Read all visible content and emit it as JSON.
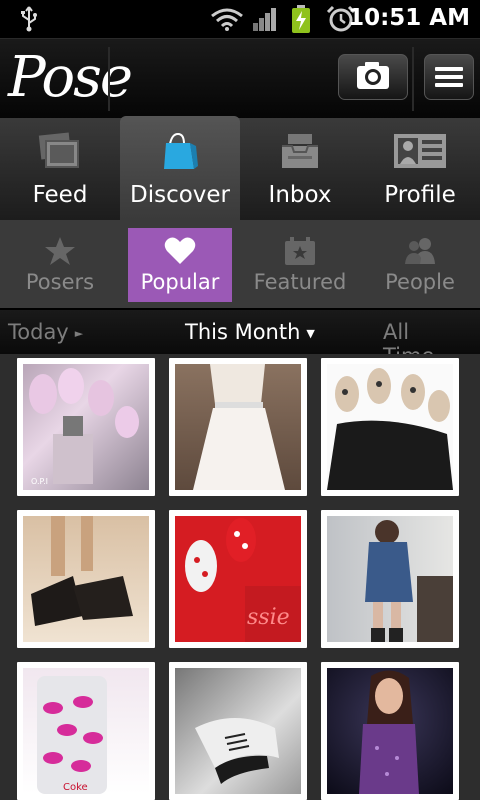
{
  "status_bar": {
    "time": "10:51 AM",
    "icons": [
      "usb-icon",
      "wifi-icon",
      "signal-icon",
      "battery-charging-icon",
      "alarm-icon"
    ]
  },
  "header": {
    "logo": "Pose",
    "camera_icon": "camera-icon",
    "menu_icon": "menu-icon"
  },
  "tabs": [
    {
      "label": "Feed",
      "icon": "photos-icon",
      "active": false
    },
    {
      "label": "Discover",
      "icon": "shopping-bag-icon",
      "active": true
    },
    {
      "label": "Inbox",
      "icon": "inbox-tray-icon",
      "active": false
    },
    {
      "label": "Profile",
      "icon": "profile-card-icon",
      "active": false
    }
  ],
  "subtabs": [
    {
      "label": "Posers",
      "icon": "star-icon",
      "active": false
    },
    {
      "label": "Popular",
      "icon": "heart-icon",
      "active": true
    },
    {
      "label": "Featured",
      "icon": "calendar-star-icon",
      "active": false
    },
    {
      "label": "People",
      "icon": "people-icon",
      "active": false
    }
  ],
  "time_filter": [
    {
      "label": "Today",
      "active": false
    },
    {
      "label": "This Month",
      "active": true
    },
    {
      "label": "All Time",
      "active": false
    }
  ],
  "accent_color": "#9b59b6",
  "photos": [
    {
      "subject": "pink nail art with nail polish bottle",
      "caption": "O.P.I"
    },
    {
      "subject": "white feathered dress"
    },
    {
      "subject": "leopard print nails"
    },
    {
      "subject": "black wedge shoes"
    },
    {
      "subject": "red and white polka dot nails with polish bottle"
    },
    {
      "subject": "denim shirt dress outfit"
    },
    {
      "subject": "soda can with lip prints",
      "caption": "Coke"
    },
    {
      "subject": "black and white lace-up heels"
    },
    {
      "subject": "performer in purple sequin dress"
    }
  ]
}
